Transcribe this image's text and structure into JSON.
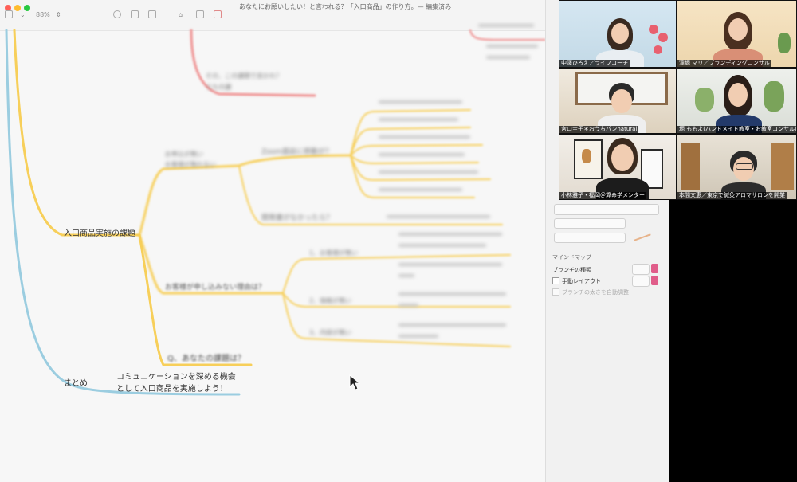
{
  "app": {
    "zoom": "88%",
    "document_title": "あなたにお願いしたい！と言われる？「入口商品」の作り方。— 編集済み"
  },
  "mindmap": {
    "branch_issue": "入口商品実施の課題",
    "branch_summary": "まとめ",
    "summary_text_line1": "コミュニケーションを深める機会",
    "summary_text_line2": "として入口商品を実施しよう！",
    "question_node": "Q、あなたの課題は？",
    "customers_not_applying": "お客様が申し込みない理由は？",
    "blurred_top": "Zoom面談に移動が？",
    "blurred_dev": "開発書がなかったら？",
    "blurred_left_line1": "お申込が無い",
    "blurred_left_line2": "お客様が無れない",
    "blurred_sub1": "1、お客様が無い",
    "blurred_sub2": "2、価格が無い",
    "blurred_sub3": "3、内容が無い",
    "blurred_red_line1": "その、この課題で良かれ？",
    "blurred_red_line2": "うちの課"
  },
  "sidebar": {
    "section_label": "マインドマップ",
    "branch_type_label": "ブランチの種類",
    "manual_layout_label": "手動レイアウト",
    "auto_size_label": "ブランチの太さを自動調整"
  },
  "participants": [
    {
      "name": "中澤ひろえ／ライフコーチ"
    },
    {
      "name": "滝堀 マリ／ブランディングコンサル"
    },
    {
      "name": "宮口圭子＊おうちパンnatural"
    },
    {
      "name": "堀 ももよ(ハンドメイド教室・お教室コンサル)"
    },
    {
      "name": "小林雅子・福岡＠算命学メンター"
    },
    {
      "name": "本間文恵／東京で鍼灸アロマサロンを開業"
    }
  ],
  "colors": {
    "yellow_branch": "#f7cf5a",
    "blue_branch": "#9bcde0",
    "red_branch": "#ef8f8f",
    "accent": "#e05d8a"
  }
}
